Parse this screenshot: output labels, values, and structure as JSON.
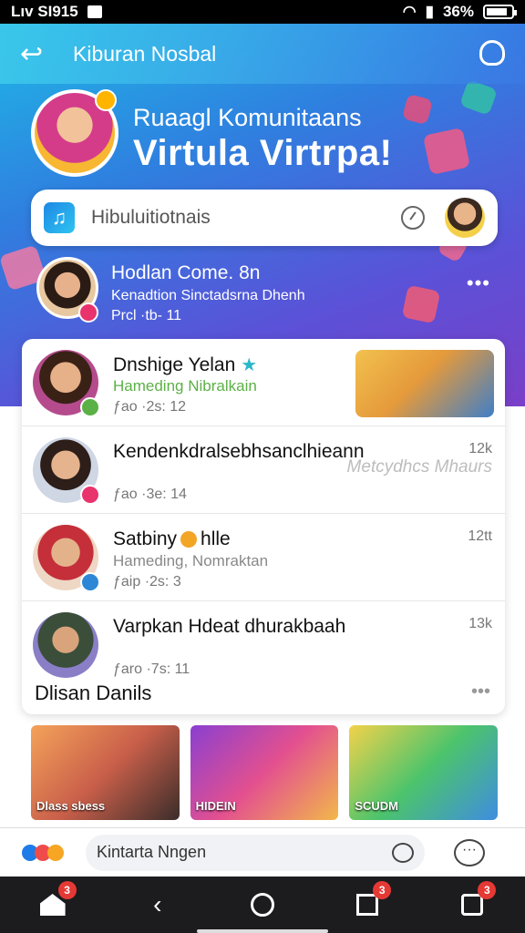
{
  "status": {
    "carrier": "Lıv SI915",
    "battery": "36%"
  },
  "header": {
    "title": "Kiburan Nosbal"
  },
  "hero": {
    "title": "Ruaagl Komunitaans",
    "subtitle": "Virtula Virtrpa!"
  },
  "search": {
    "placeholder": "Hibuluitiotnais"
  },
  "featured": {
    "name": "Hodlan Come. 8n",
    "subtitle": "Kenadtion Sinctadsrna Dhenh",
    "meta": "Prcl ·tb- 11"
  },
  "feed": [
    {
      "name": "Dnshige Yelan",
      "sub": "Hameding Nibralkain",
      "meta": "ƒao ·2s: 12",
      "count": ""
    },
    {
      "name": "Kendenkdralsebhsanclhieann",
      "sub": "",
      "meta": "ƒao ·3e: 14",
      "count": "12k",
      "overlay": "Metcydhcs Mhaurs"
    },
    {
      "name": "Satbiny",
      "name_suffix": "hlle",
      "sub": "Hameding, Nomraktan",
      "meta": "ƒaip ·2s: 3",
      "count": "12tt"
    },
    {
      "name": "Varpkan Hdeat dhurakbaah",
      "sub": "",
      "meta": "ƒaro ·7s: 11",
      "count": "13k"
    }
  ],
  "section": {
    "title": "Dlisan Danils"
  },
  "thumbs": [
    {
      "label": "Dlass sbess"
    },
    {
      "label": "HIDEIN"
    },
    {
      "label": "SCUDM"
    }
  ],
  "compose": {
    "placeholder": "Kintarta Nngen"
  },
  "nav": {
    "home_badge": "3",
    "recents_badge": "3",
    "profile_badge": "3"
  },
  "colors": {
    "accent": "#2f7fdf",
    "badge": "#e53935",
    "green": "#5bb046"
  }
}
